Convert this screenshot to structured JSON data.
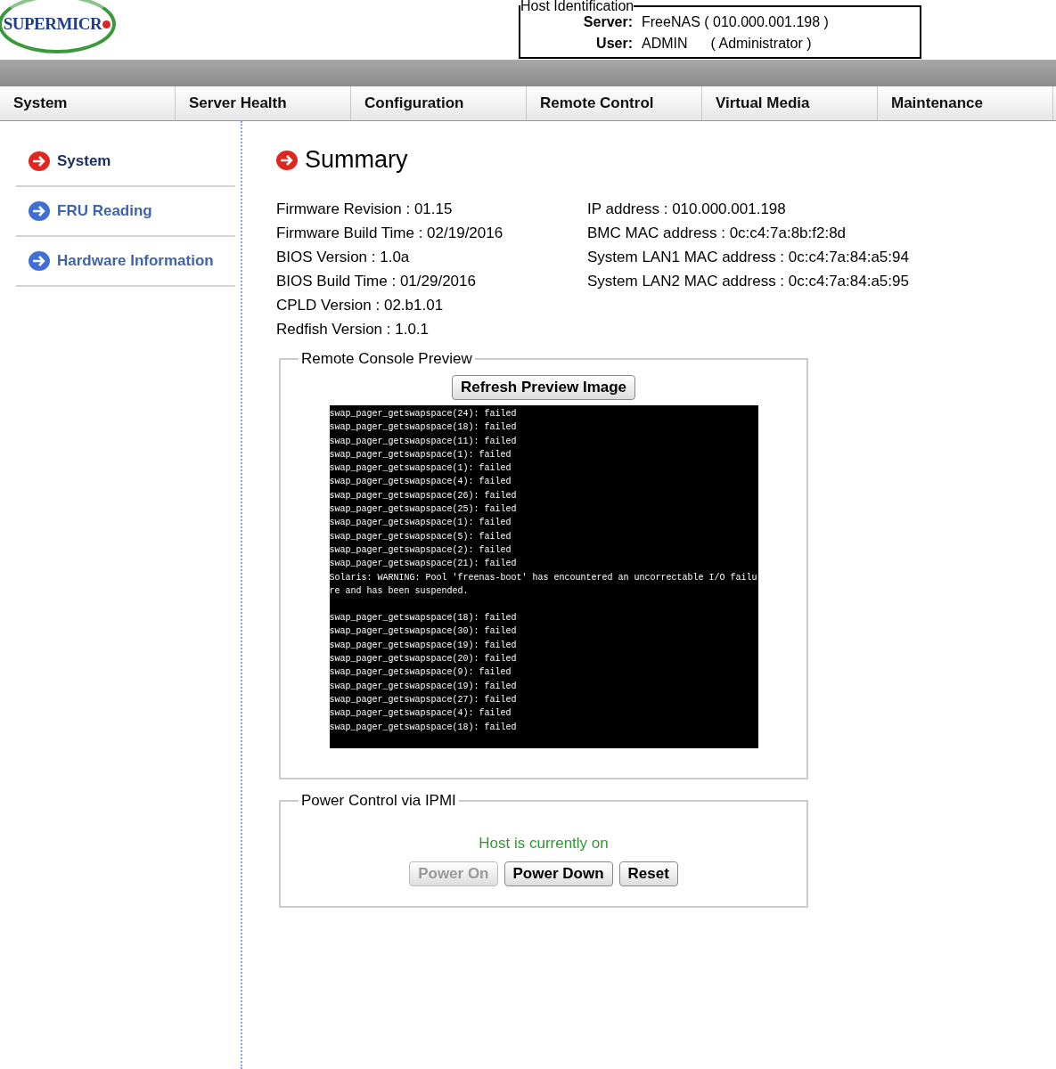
{
  "logo": "SUPERMICR",
  "host": {
    "legend": "Host Identification",
    "server_label": "Server:",
    "server_value": "FreeNAS  ( 010.000.001.198 )",
    "user_label": "User:",
    "user_value": "ADMIN",
    "user_role": "( Administrator )"
  },
  "nav": [
    {
      "label": "System",
      "selected": false
    },
    {
      "label": "Server Health",
      "selected": false
    },
    {
      "label": "Configuration",
      "selected": false
    },
    {
      "label": "Remote Control",
      "selected": false
    },
    {
      "label": "Virtual Media",
      "selected": false
    },
    {
      "label": "Maintenance",
      "selected": false
    }
  ],
  "sidebar": {
    "items": [
      {
        "label": "System",
        "selected": true
      },
      {
        "label": "FRU Reading",
        "selected": false
      },
      {
        "label": "Hardware Information",
        "selected": false
      }
    ]
  },
  "title": "Summary",
  "info_left": [
    "Firmware Revision :  01.15",
    "Firmware Build Time :  02/19/2016",
    "BIOS Version : 1.0a",
    "BIOS Build Time : 01/29/2016",
    "CPLD Version : 02.b1.01",
    "Redfish Version : 1.0.1"
  ],
  "info_right": [
    "IP address :  010.000.001.198",
    "BMC MAC address :  0c:c4:7a:8b:f2:8d",
    "System LAN1 MAC address : 0c:c4:7a:84:a5:94",
    "System LAN2 MAC address : 0c:c4:7a:84:a5:95"
  ],
  "console": {
    "legend": "Remote Console Preview",
    "button": "Refresh Preview Image",
    "lines": [
      "swap_pager_getswapspace(24): failed",
      "swap_pager_getswapspace(18): failed",
      "swap_pager_getswapspace(11): failed",
      "swap_pager_getswapspace(1): failed",
      "swap_pager_getswapspace(1): failed",
      "swap_pager_getswapspace(4): failed",
      "swap_pager_getswapspace(26): failed",
      "swap_pager_getswapspace(25): failed",
      "swap_pager_getswapspace(1): failed",
      "swap_pager_getswapspace(5): failed",
      "swap_pager_getswapspace(2): failed",
      "swap_pager_getswapspace(21): failed",
      "Solaris: WARNING: Pool 'freenas-boot' has encountered an uncorrectable I/O failu",
      "re and has been suspended.",
      "swap_pager_getswapspace(18): failed",
      "swap_pager_getswapspace(30): failed",
      "swap_pager_getswapspace(19): failed",
      "swap_pager_getswapspace(20): failed",
      "swap_pager_getswapspace(9): failed",
      "swap_pager_getswapspace(19): failed",
      "swap_pager_getswapspace(27): failed",
      "swap_pager_getswapspace(4): failed",
      "swap_pager_getswapspace(18): failed"
    ]
  },
  "power": {
    "legend": "Power Control via IPMI",
    "status": "Host is currently on",
    "buttons": [
      {
        "label": "Power On",
        "disabled": true
      },
      {
        "label": "Power Down",
        "disabled": false
      },
      {
        "label": "Reset",
        "disabled": false
      }
    ]
  }
}
